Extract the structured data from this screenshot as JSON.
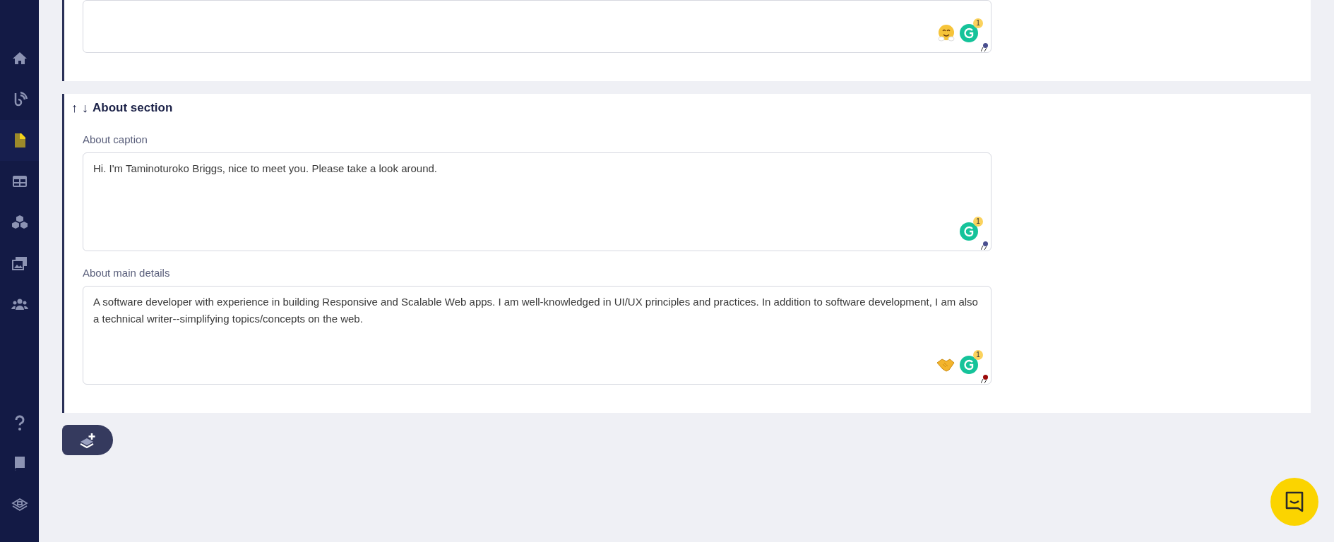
{
  "sidebar": {
    "top_items": [
      {
        "kind": "home",
        "selected": false
      },
      {
        "kind": "blog",
        "selected": false
      },
      {
        "kind": "document",
        "selected": true
      },
      {
        "kind": "table",
        "selected": false
      },
      {
        "kind": "cubes",
        "selected": false
      },
      {
        "kind": "images",
        "selected": false
      },
      {
        "kind": "users",
        "selected": false
      }
    ],
    "bottom_items": [
      {
        "kind": "help",
        "selected": false
      },
      {
        "kind": "book",
        "selected": false
      },
      {
        "kind": "layers",
        "selected": false
      }
    ]
  },
  "top_section": {
    "fields": [
      {
        "kind": "hug",
        "grammar_count": "1",
        "color": "#4a4f8e"
      }
    ]
  },
  "about_section": {
    "move_arrows": [
      "↑",
      "↓"
    ],
    "title": "About section",
    "fields": [
      {
        "kind": "plain",
        "label": "About caption",
        "value": "Hi. I'm Taminoturoko Briggs, nice to meet you. Please take a look around.",
        "grammar_count": "1",
        "color": "#4a4f8e"
      },
      {
        "kind": "handshake",
        "label": "About main details",
        "value": "A software developer with experience in building Responsive and Scalable Web apps. I am well-knowledged in UI/UX principles and practices. In addition to software development, I am also a technical writer--simplifying topics/concepts on the web.",
        "grammar_count": "1",
        "color": "#9b0a0a"
      }
    ]
  }
}
